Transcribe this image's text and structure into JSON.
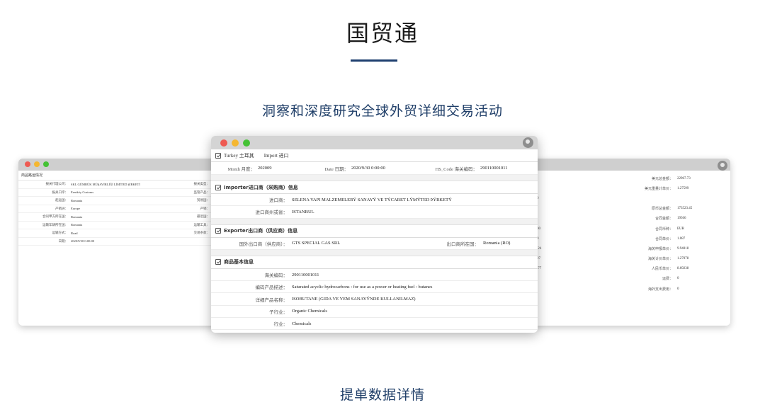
{
  "header": {
    "title": "国贸通",
    "subtitle": "洞察和深度研究全球外贸详细交易活动",
    "bottom_caption": "提单数据详情"
  },
  "colors": {
    "accent": "#1e3f6f",
    "close": "#ee5a52",
    "minimize": "#f5b731",
    "maximize": "#45c235"
  },
  "icons": [
    "user-avatar-icon",
    "section-check-icon"
  ],
  "center": {
    "top": {
      "country": "Turkey 土耳其",
      "direction": "Import 进口"
    },
    "meta": {
      "month_label": "Month 月度：",
      "month": "202009",
      "date_label": "Date 日期：",
      "date": "2020/9/30 0:00:00",
      "hs_label": "HS_Code 海关编码：",
      "hs": "290110001011"
    },
    "importer": {
      "title_en": "Importer",
      "title_cn": "进口商（采购商）信息",
      "rows": [
        {
          "k": "进口商：",
          "v": "SELENA YAPI MALZEMELERÝ SANAYÝ VE TÝCARET LÝMÝTED ÞÝRKETÝ"
        },
        {
          "k": "进口商州或省：",
          "v": "ISTANBUL"
        }
      ]
    },
    "exporter": {
      "title_en": "Exporter",
      "title_cn": "出口商（供应商）信息",
      "k1": "国外出口商（供应商）：",
      "v1": "GTS SPECIAL GAS SRL",
      "k2": "出口商所在国：",
      "v2": "Romania (RO)"
    },
    "product": {
      "title": "商品基本信息",
      "rows": [
        {
          "k": "海关编码：",
          "v": "290110001011"
        },
        {
          "k": "编码产品描述：",
          "v": "Saturated acyclic hydrocarbons : for use as a power or heating fuel : butanes"
        },
        {
          "k": "详细产品名称：",
          "v": "ISOBUTANE (GIDA VE YEM SANAYÝNDE KULLANILMAZ)"
        },
        {
          "k": "子行业：",
          "v": "Organic Chemicals"
        },
        {
          "k": "行业：",
          "v": "Chemicals"
        }
      ]
    }
  },
  "left": {
    "section": "商品路运情况",
    "rows": [
      {
        "k": "报关代理公司：",
        "v": "SKL GÜMRÜK MÜŞAVİRLİĞİ LİMİTED ŞİRKETİ",
        "k2": "报关类型："
      },
      {
        "k": "报关口岸：",
        "v": "Erenköy Customs",
        "k2": "监管产品："
      },
      {
        "k": "起运国：",
        "v": "Romania",
        "k2": "贸易国："
      },
      {
        "k": "产销洲：",
        "v": "Europe",
        "k2": "产销："
      },
      {
        "k": "合同甲方所在国：",
        "v": "Romania",
        "k2": "最近国："
      },
      {
        "k": "运输车辆所在国：",
        "v": "Romania",
        "k2": "运输工具："
      },
      {
        "k": "运输方式：",
        "v": "Road",
        "k2": "交易条款："
      },
      {
        "k": "日期：",
        "v": "2020/9/30 0:00:00",
        "k2": ""
      }
    ]
  },
  "right": {
    "rows": [
      {
        "lv": "",
        "k": "美元总金额：",
        "v": "22967.73"
      },
      {
        "lv": "",
        "k": "美元重量计单价：",
        "v": "1.27599"
      },
      {
        "lv": "0",
        "k": "",
        "v": ""
      },
      {
        "lv": "",
        "k": "原币总金额：",
        "v": "173523.45"
      },
      {
        "lv": "",
        "k": "合同金额：",
        "v": "19566"
      },
      {
        "lv": "00",
        "k": "合同币种：",
        "v": "EUR"
      },
      {
        "lv": "9",
        "k": "合同单价：",
        "v": "1.087"
      },
      {
        "lv": ".24",
        "k": "海关申报单价：",
        "v": "9.94018"
      },
      {
        "lv": "07",
        "k": "海关计价单价：",
        "v": "1.27078"
      },
      {
        "lv": ".77",
        "k": "人民币单价：",
        "v": "8.69238"
      },
      {
        "lv": "",
        "k": "运费：",
        "v": "0"
      },
      {
        "lv": "",
        "k": "海外支出费用：",
        "v": "0"
      }
    ]
  }
}
